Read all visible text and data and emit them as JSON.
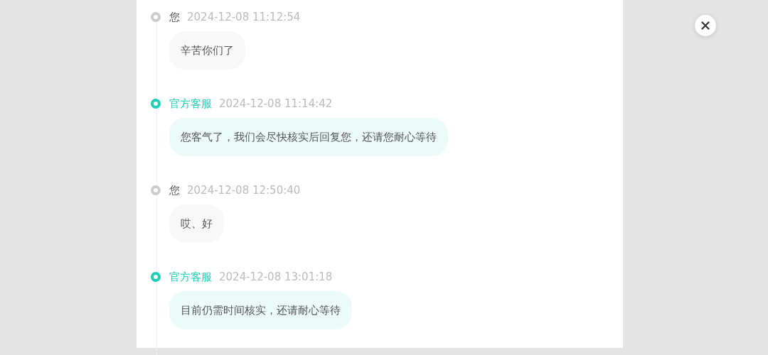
{
  "messages": [
    {
      "kind": "user",
      "sender": "您",
      "time": "2024-12-08 11:12:54",
      "text": "辛苦你们了"
    },
    {
      "kind": "agent",
      "sender": "官方客服",
      "time": "2024-12-08 11:14:42",
      "text": "您客气了，我们会尽快核实后回复您，还请您耐心等待"
    },
    {
      "kind": "user",
      "sender": "您",
      "time": "2024-12-08 12:50:40",
      "text": "哎、好"
    },
    {
      "kind": "agent",
      "sender": "官方客服",
      "time": "2024-12-08 13:01:18",
      "text": "目前仍需时间核实，还请耐心等待"
    }
  ]
}
